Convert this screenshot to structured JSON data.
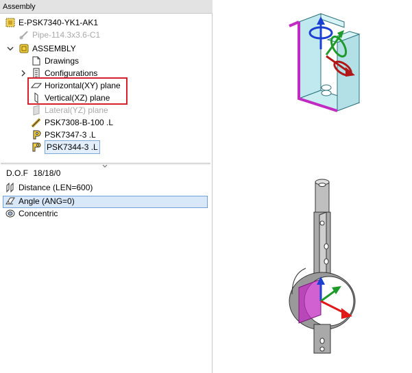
{
  "window": {
    "title": "Assembly"
  },
  "tree": {
    "items": [
      {
        "label": "E-PSK7340-YK1-AK1",
        "muted": false
      },
      {
        "label": "Pipe-114.3x3.6-C1",
        "muted": true
      },
      {
        "label": "ASSEMBLY",
        "muted": false
      },
      {
        "label": "Drawings",
        "muted": false
      },
      {
        "label": "Configurations",
        "muted": false
      },
      {
        "label": "Horizontal(XY) plane",
        "muted": false
      },
      {
        "label": "Vertical(XZ) plane",
        "muted": false
      },
      {
        "label": "Lateral(YZ) plane",
        "muted": true
      },
      {
        "label": "PSK7308-B-100 .L",
        "muted": false
      },
      {
        "label": "PSK7347-3 .L",
        "muted": false
      },
      {
        "label": "PSK7344-3 .L",
        "muted": false,
        "selected": true
      }
    ]
  },
  "constraints": {
    "dof_label": "D.O.F",
    "dof_value": "18/18/0",
    "items": [
      {
        "label": "Distance (LEN=600)"
      },
      {
        "label": "Angle (ANG=0)",
        "selected": true
      },
      {
        "label": "Concentric"
      }
    ]
  },
  "icons": {
    "assembly_root": "assembly-root-icon",
    "pipe": "pipe-icon",
    "assembly": "assembly-icon",
    "drawings": "drawing-icon",
    "configurations": "configurations-icon",
    "plane": "plane-icon",
    "part": "part-icon",
    "distance": "distance-constraint-icon",
    "angle": "angle-constraint-icon",
    "concentric": "concentric-constraint-icon"
  },
  "colors": {
    "highlight": "#d61f2a",
    "selection": "#d9e8f9",
    "selection_border": "#6f9fd6",
    "muted_text": "#a9a9a9"
  }
}
